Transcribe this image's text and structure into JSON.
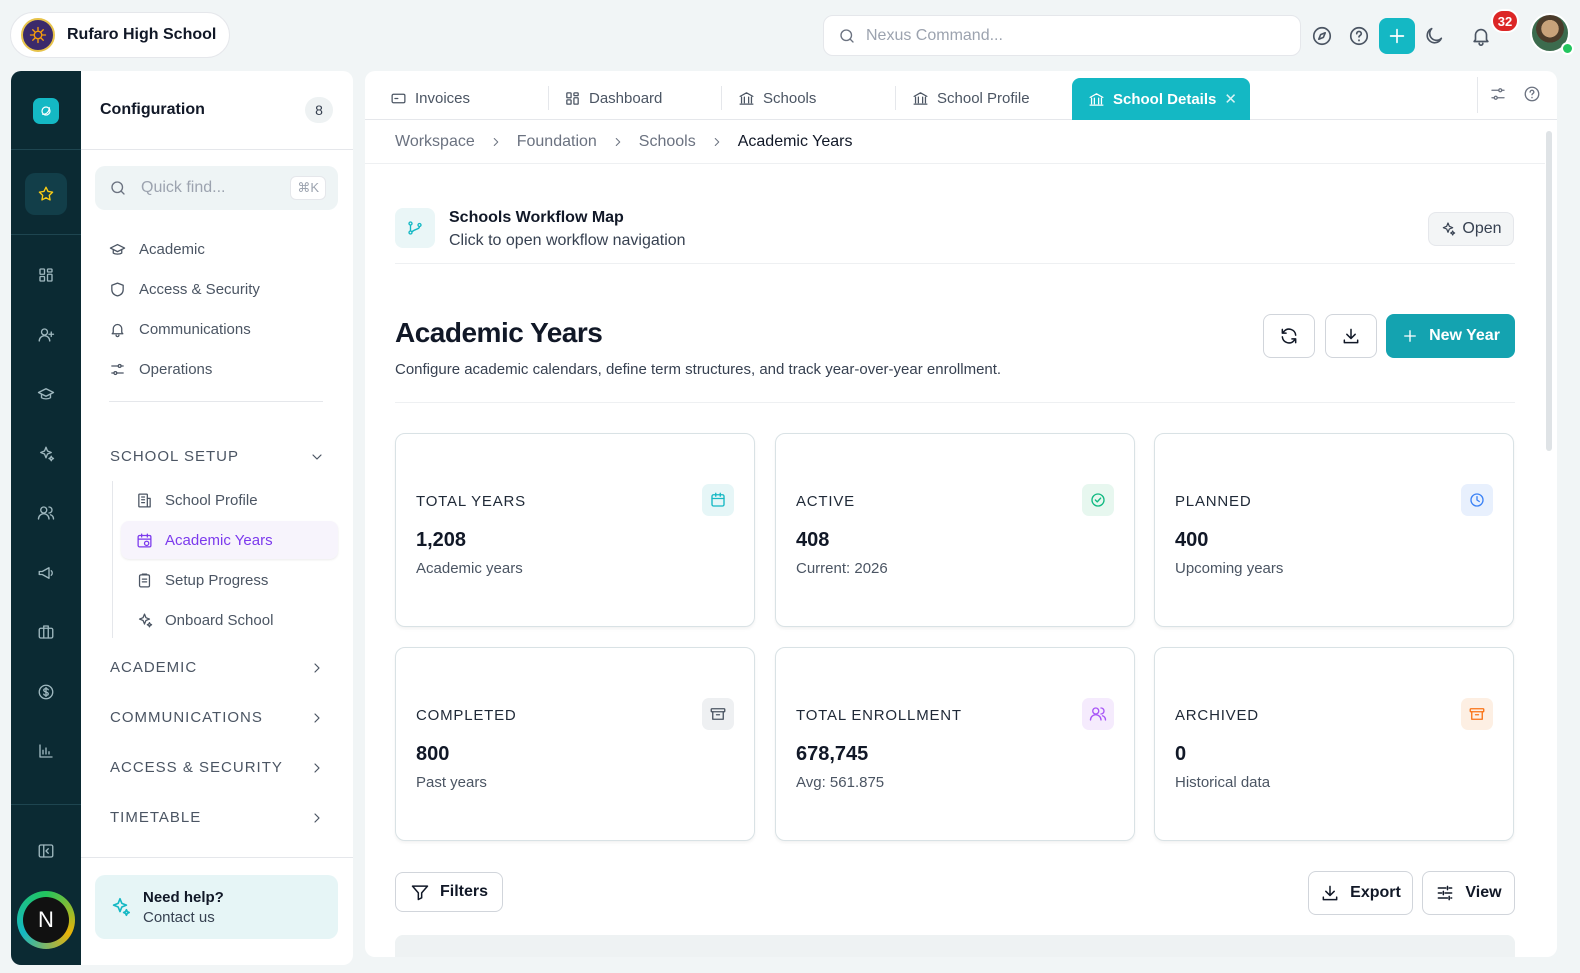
{
  "app": {
    "school_name": "Rufaro High School",
    "notifications": "32",
    "user_initial": "N"
  },
  "search": {
    "placeholder": "Nexus Command..."
  },
  "config": {
    "title": "Configuration",
    "count": "8",
    "quick_find_placeholder": "Quick find...",
    "shortcut": "⌘K",
    "nav": [
      "Academic",
      "Access & Security",
      "Communications",
      "Operations"
    ],
    "sections": {
      "school_setup": "SCHOOL SETUP",
      "academic": "ACADEMIC",
      "communications": "COMMUNICATIONS",
      "access_security": "ACCESS & SECURITY",
      "timetable": "TIMETABLE"
    },
    "school_setup_items": [
      "School Profile",
      "Academic Years",
      "Setup Progress",
      "Onboard School"
    ],
    "help_title": "Need help?",
    "help_sub": "Contact us"
  },
  "tabs": [
    "Invoices",
    "Dashboard",
    "Schools",
    "School Profile",
    "School Details"
  ],
  "breadcrumb": [
    "Workspace",
    "Foundation",
    "Schools",
    "Academic Years"
  ],
  "workflow": {
    "title": "Schools Workflow Map",
    "subtitle": "Click to open workflow navigation",
    "open_label": "Open"
  },
  "page": {
    "title": "Academic Years",
    "description": "Configure academic calendars, define term structures, and track year-over-year enrollment.",
    "new_label": "New Year"
  },
  "stats": [
    {
      "label": "TOTAL YEARS",
      "value": "1,208",
      "sub": "Academic years",
      "icon": "calendar-icon",
      "color": "#14b8c4",
      "bg": "#e6f6f7"
    },
    {
      "label": "ACTIVE",
      "value": "408",
      "sub": "Current: 2026",
      "icon": "check-circle-icon",
      "color": "#10b981",
      "bg": "#e7f7ef"
    },
    {
      "label": "PLANNED",
      "value": "400",
      "sub": "Upcoming years",
      "icon": "clock-icon",
      "color": "#3b82f6",
      "bg": "#e8f0fd"
    },
    {
      "label": "COMPLETED",
      "value": "800",
      "sub": "Past years",
      "icon": "archive-icon",
      "color": "#4b5563",
      "bg": "#eef0f2"
    },
    {
      "label": "TOTAL ENROLLMENT",
      "value": "678,745",
      "sub": "Avg: 561.875",
      "icon": "users-icon",
      "color": "#a855f7",
      "bg": "#f5ebfd"
    },
    {
      "label": "ARCHIVED",
      "value": "0",
      "sub": "Historical data",
      "icon": "archive-icon",
      "color": "#f97316",
      "bg": "#fdefe3"
    }
  ],
  "toolbar": {
    "filters_label": "Filters",
    "export_label": "Export",
    "view_label": "View"
  }
}
